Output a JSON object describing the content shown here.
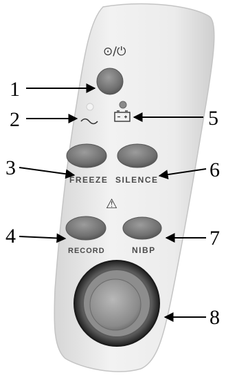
{
  "panel": {
    "power_symbol": "⊙/⏻",
    "ac_symbol": "~",
    "battery_symbol": "battery-icon",
    "alarm_symbol": "⚠",
    "keys": {
      "freeze": "FREEZE",
      "silence": "SILENCE",
      "record": "RECORD",
      "nibp": "NIBP"
    }
  },
  "callouts": [
    "1",
    "2",
    "3",
    "4",
    "5",
    "6",
    "7",
    "8"
  ],
  "colors": {
    "panel_body": "#e9e9e9",
    "button_gray": "#777777",
    "knob_ring": "#2e2e2e",
    "knob_face": "#9a9a9a"
  }
}
